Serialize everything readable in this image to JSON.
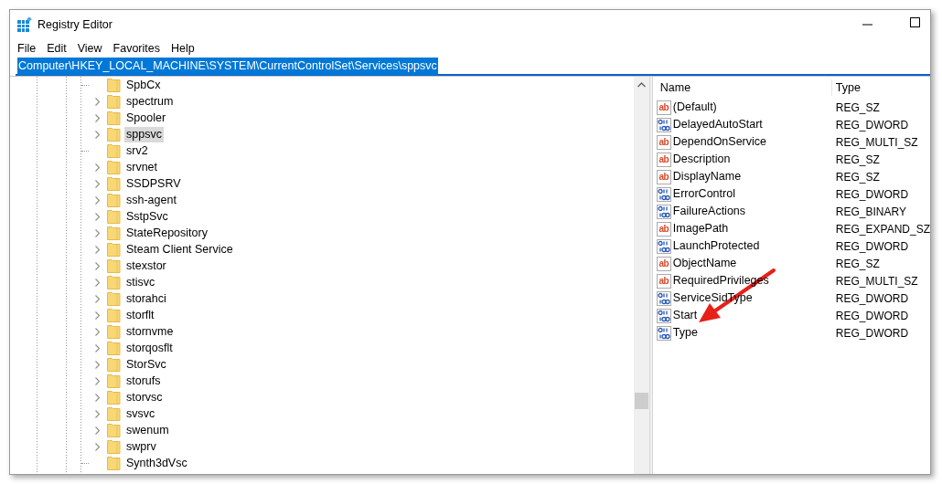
{
  "window": {
    "title": "Registry Editor"
  },
  "menu": [
    "File",
    "Edit",
    "View",
    "Favorites",
    "Help"
  ],
  "address": {
    "value": "Computer\\HKEY_LOCAL_MACHINE\\SYSTEM\\CurrentControlSet\\Services\\sppsvc",
    "selected": true
  },
  "tree": [
    {
      "label": "SpbCx",
      "expandable": false,
      "selected": false
    },
    {
      "label": "spectrum",
      "expandable": true,
      "selected": false
    },
    {
      "label": "Spooler",
      "expandable": true,
      "selected": false
    },
    {
      "label": "sppsvc",
      "expandable": true,
      "selected": true
    },
    {
      "label": "srv2",
      "expandable": false,
      "selected": false
    },
    {
      "label": "srvnet",
      "expandable": true,
      "selected": false
    },
    {
      "label": "SSDPSRV",
      "expandable": true,
      "selected": false
    },
    {
      "label": "ssh-agent",
      "expandable": true,
      "selected": false
    },
    {
      "label": "SstpSvc",
      "expandable": true,
      "selected": false
    },
    {
      "label": "StateRepository",
      "expandable": true,
      "selected": false
    },
    {
      "label": "Steam Client Service",
      "expandable": true,
      "selected": false
    },
    {
      "label": "stexstor",
      "expandable": true,
      "selected": false
    },
    {
      "label": "stisvc",
      "expandable": true,
      "selected": false
    },
    {
      "label": "storahci",
      "expandable": true,
      "selected": false
    },
    {
      "label": "storflt",
      "expandable": true,
      "selected": false
    },
    {
      "label": "stornvme",
      "expandable": true,
      "selected": false
    },
    {
      "label": "storqosflt",
      "expandable": true,
      "selected": false
    },
    {
      "label": "StorSvc",
      "expandable": true,
      "selected": false
    },
    {
      "label": "storufs",
      "expandable": true,
      "selected": false
    },
    {
      "label": "storvsc",
      "expandable": true,
      "selected": false
    },
    {
      "label": "svsvc",
      "expandable": true,
      "selected": false
    },
    {
      "label": "swenum",
      "expandable": true,
      "selected": false
    },
    {
      "label": "swprv",
      "expandable": true,
      "selected": false
    },
    {
      "label": "Synth3dVsc",
      "expandable": false,
      "selected": false
    }
  ],
  "values": {
    "columns": [
      "Name",
      "Type"
    ],
    "rows": [
      {
        "kind": "string",
        "icon": "ab",
        "name": "(Default)",
        "type": "REG_SZ"
      },
      {
        "kind": "binary",
        "name": "DelayedAutoStart",
        "type": "REG_DWORD"
      },
      {
        "kind": "string",
        "icon": "ab",
        "name": "DependOnService",
        "type": "REG_MULTI_SZ"
      },
      {
        "kind": "string",
        "icon": "ab",
        "name": "Description",
        "type": "REG_SZ"
      },
      {
        "kind": "string",
        "icon": "ab",
        "name": "DisplayName",
        "type": "REG_SZ"
      },
      {
        "kind": "binary",
        "name": "ErrorControl",
        "type": "REG_DWORD"
      },
      {
        "kind": "binary",
        "name": "FailureActions",
        "type": "REG_BINARY"
      },
      {
        "kind": "string",
        "icon": "ab",
        "name": "ImagePath",
        "type": "REG_EXPAND_SZ"
      },
      {
        "kind": "binary",
        "name": "LaunchProtected",
        "type": "REG_DWORD"
      },
      {
        "kind": "string",
        "icon": "ab",
        "name": "ObjectName",
        "type": "REG_SZ"
      },
      {
        "kind": "string",
        "icon": "ab",
        "name": "RequiredPrivileges",
        "type": "REG_MULTI_SZ"
      },
      {
        "kind": "binary",
        "name": "ServiceSidType",
        "type": "REG_DWORD"
      },
      {
        "kind": "binary",
        "name": "Start",
        "type": "REG_DWORD"
      },
      {
        "kind": "binary",
        "name": "Type",
        "type": "REG_DWORD"
      }
    ]
  }
}
